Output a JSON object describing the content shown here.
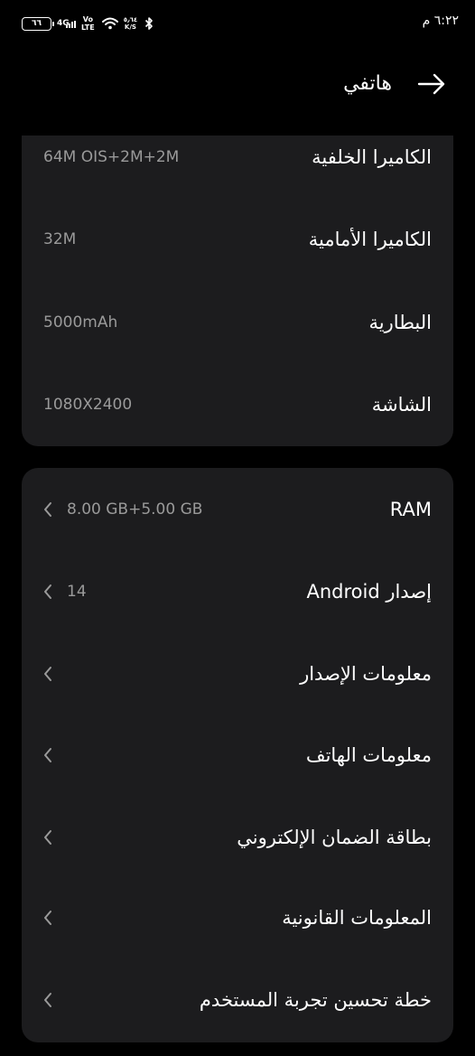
{
  "status_bar": {
    "battery": "٦٦",
    "network": "4G",
    "volte_top": "Vo",
    "volte_bottom": "LTE",
    "speed_value": "٥٫٦٤",
    "speed_unit": "K/S",
    "time": "٦:٢٢ م"
  },
  "header": {
    "title": "هاتفي"
  },
  "specs": [
    {
      "label": "الكاميرا الخلفية",
      "value": "64M OIS+2M+2M"
    },
    {
      "label": "الكاميرا الأمامية",
      "value": "32M"
    },
    {
      "label": "البطارية",
      "value": "5000mAh"
    },
    {
      "label": "الشاشة",
      "value": "1080X2400"
    }
  ],
  "menu": [
    {
      "label": "RAM",
      "value": "8.00 GB+5.00 GB"
    },
    {
      "label": "إصدار Android",
      "value": "14"
    },
    {
      "label": "معلومات الإصدار",
      "value": ""
    },
    {
      "label": "معلومات الهاتف",
      "value": ""
    },
    {
      "label": "بطاقة الضمان الإلكتروني",
      "value": ""
    },
    {
      "label": "المعلومات القانونية",
      "value": ""
    },
    {
      "label": "خطة تحسين تجربة المستخدم",
      "value": ""
    }
  ],
  "colors": {
    "background": "#000000",
    "card": "#1c1c1e",
    "primary_text": "#ffffff",
    "secondary_text": "#9a9a9a"
  }
}
